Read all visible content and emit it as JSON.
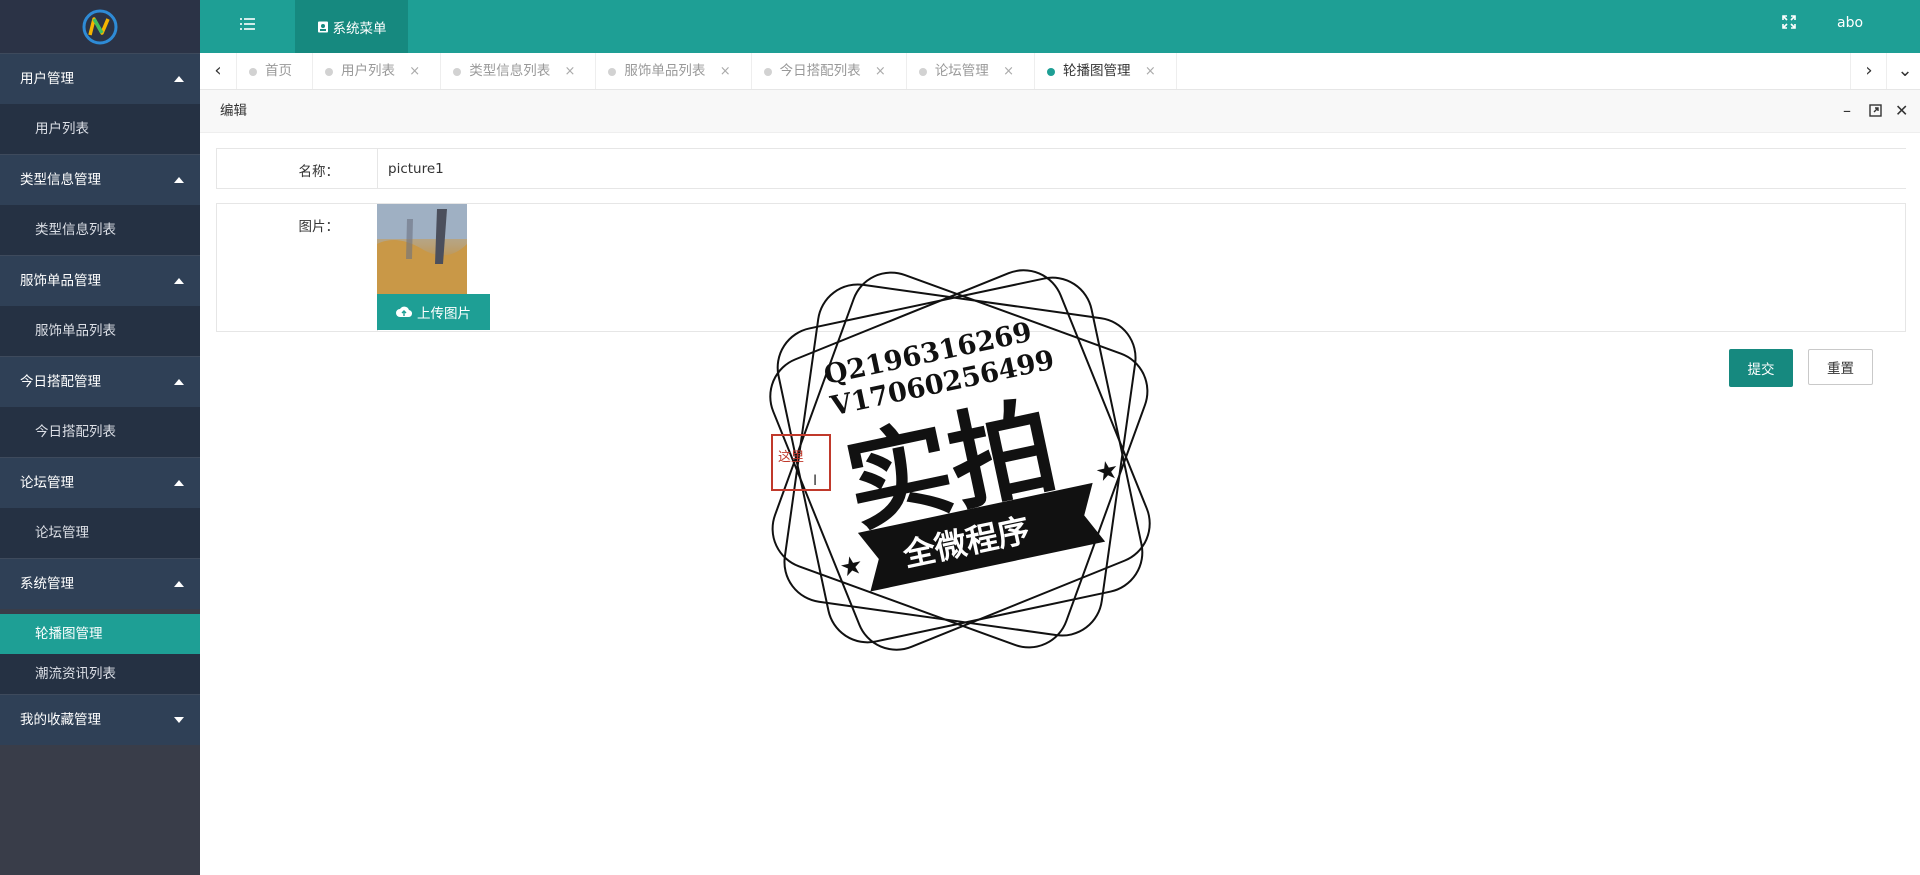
{
  "header": {
    "system_menu": "系统菜单",
    "user": "abo"
  },
  "sidebar": {
    "groups": [
      {
        "title": "用户管理",
        "items": [
          "用户列表"
        ],
        "expanded": true
      },
      {
        "title": "类型信息管理",
        "items": [
          "类型信息列表"
        ],
        "expanded": true
      },
      {
        "title": "服饰单品管理",
        "items": [
          "服饰单品列表"
        ],
        "expanded": true
      },
      {
        "title": "今日搭配管理",
        "items": [
          "今日搭配列表"
        ],
        "expanded": true
      },
      {
        "title": "论坛管理",
        "items": [
          "论坛管理"
        ],
        "expanded": true
      },
      {
        "title": "系统管理",
        "items": [
          "轮播图管理",
          "潮流资讯列表"
        ],
        "expanded": true,
        "active_item": "轮播图管理"
      },
      {
        "title": "我的收藏管理",
        "items": [],
        "expanded": false
      }
    ]
  },
  "tabs": [
    {
      "label": "首页",
      "closable": false
    },
    {
      "label": "用户列表",
      "closable": true
    },
    {
      "label": "类型信息列表",
      "closable": true
    },
    {
      "label": "服饰单品列表",
      "closable": true
    },
    {
      "label": "今日搭配列表",
      "closable": true
    },
    {
      "label": "论坛管理",
      "closable": true
    },
    {
      "label": "轮播图管理",
      "closable": true,
      "active": true
    }
  ],
  "dialog": {
    "title": "编辑",
    "name_label": "名称：",
    "name_value": "picture1",
    "image_label": "图片：",
    "upload_label": "上传图片",
    "submit_label": "提交",
    "reset_label": "重置"
  },
  "watermark": {
    "line1": "Q2196316269",
    "line2": "V17060256499",
    "big_text": "实拍",
    "banner_text": "全微程序",
    "edit_text": "这里"
  },
  "colors": {
    "accent": "#1e9f95",
    "sidebar_bg": "#393d49",
    "edit_border": "#c0392b"
  }
}
